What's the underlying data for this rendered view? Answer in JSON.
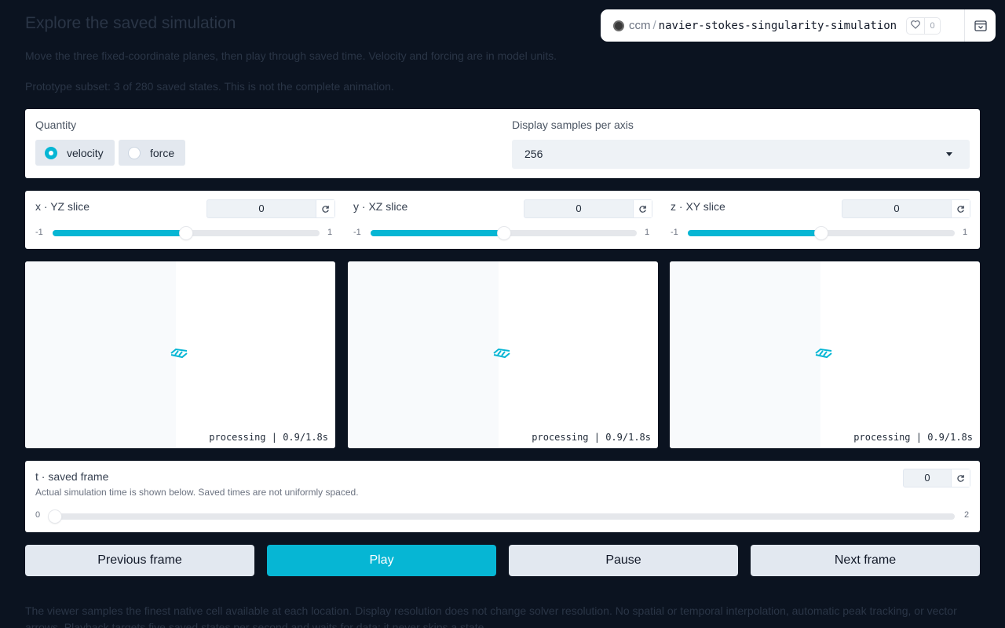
{
  "intro": {
    "title": "Explore the saved simulation",
    "line1": "Move the three fixed-coordinate planes, then play through saved time. Velocity and forcing are in model units.",
    "line2": "Prototype subset: 3 of 280 saved states. This is not the complete animation."
  },
  "hub": {
    "owner": "ccm",
    "separator": "/",
    "repo": "navier-stokes-singularity-simulation",
    "likes": "0"
  },
  "quantity": {
    "label": "Quantity",
    "options": [
      {
        "label": "velocity",
        "selected": true
      },
      {
        "label": "force",
        "selected": false
      }
    ]
  },
  "samples": {
    "label": "Display samples per axis",
    "value": "256"
  },
  "slices": [
    {
      "label": "x · YZ slice",
      "value": "0",
      "min": "-1",
      "max": "1",
      "position": 0.5
    },
    {
      "label": "y · XZ slice",
      "value": "0",
      "min": "-1",
      "max": "1",
      "position": 0.5
    },
    {
      "label": "z · XY slice",
      "value": "0",
      "min": "-1",
      "max": "1",
      "position": 0.5
    }
  ],
  "views": [
    {
      "status": "processing | 0.9/1.8s"
    },
    {
      "status": "processing | 0.9/1.8s"
    },
    {
      "status": "processing | 0.9/1.8s"
    }
  ],
  "time": {
    "label": "t · saved frame",
    "note": "Actual simulation time is shown below. Saved times are not uniformly spaced.",
    "value": "0",
    "min": "0",
    "max": "2",
    "position": 0
  },
  "buttons": {
    "prev": "Previous frame",
    "play": "Play",
    "pause": "Pause",
    "next": "Next frame"
  },
  "footer": {
    "text": "The viewer samples the finest native cell available at each location. Display resolution does not change solver resolution. No spatial or temporal interpolation, automatic peak tracking, or vector arrows. Playback targets five saved states per second and waits for data; it never skips a state."
  },
  "colors": {
    "accent": "#06b6d4",
    "background": "#0b1320"
  }
}
